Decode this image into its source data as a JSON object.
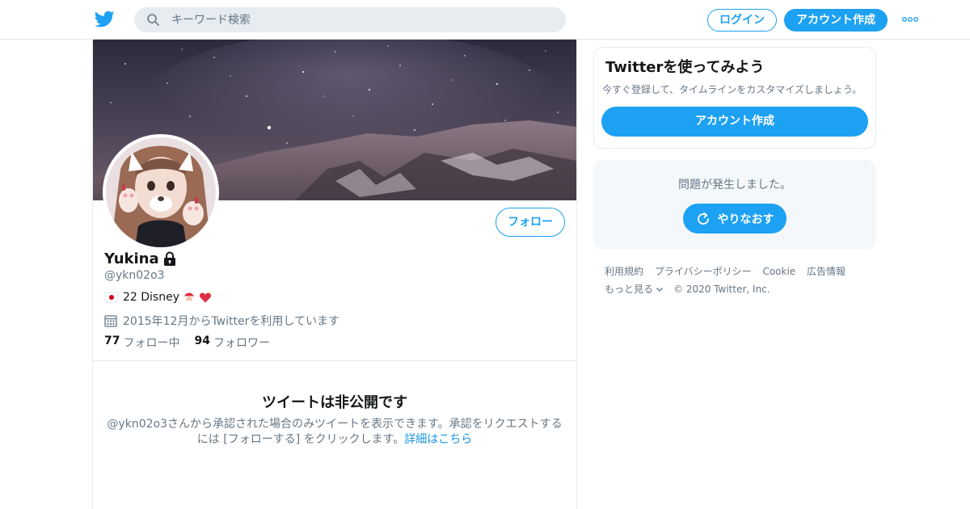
{
  "topbar": {
    "search_placeholder": "キーワード検索",
    "login_label": "ログイン",
    "signup_label": "アカウント作成",
    "logo_icon": "twitter-bird-icon",
    "more_icon": "more-dots-icon"
  },
  "profile": {
    "name": "Yukina",
    "handle": "@ykn02o3",
    "bio": "22 Disney",
    "joined": "2015年12月からTwitterを利用しています",
    "following_count": "77",
    "following_label": "フォロー中",
    "followers_count": "94",
    "followers_label": "フォロワー",
    "follow_button": "フォロー",
    "protected_icon": "lock-icon"
  },
  "private_notice": {
    "title": "ツイートは非公開です",
    "desc": "@ykn02o3さんから承認された場合のみツイートを表示できます。承認をリクエストするには [フォローする] をクリックします。",
    "link": "詳細はこちら"
  },
  "sidebar": {
    "signup_card": {
      "title": "Twitterを使ってみよう",
      "desc": "今すぐ登録して、タイムラインをカスタマイズしましょう。",
      "button": "アカウント作成"
    },
    "error_card": {
      "message": "問題が発生しました。",
      "retry_button": "やりなおす"
    },
    "footer": {
      "links": [
        "利用規約",
        "プライバシーポリシー",
        "Cookie",
        "広告情報"
      ],
      "more": "もっと見る",
      "copyright": "© 2020 Twitter, Inc."
    }
  },
  "colors": {
    "accent": "#1da1f2",
    "text_primary": "#14171a",
    "text_secondary": "#657786",
    "border": "#e6ecf0"
  }
}
